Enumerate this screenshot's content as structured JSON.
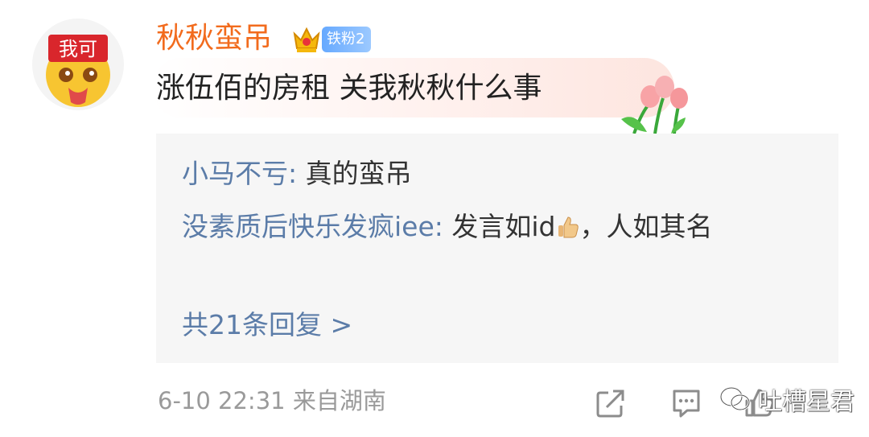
{
  "comment": {
    "username": "秋秋蛮吊",
    "badge": {
      "crown_icon": "crown-icon",
      "fan_label": "铁粉2"
    },
    "text": "涨伍佰的房租 关我秋秋什么事",
    "avatar_text": "我可",
    "decoration_icon": "tulip-icon"
  },
  "replies": [
    {
      "author": "小马不亏",
      "separator": ": ",
      "text": "真的蛮吊"
    },
    {
      "author": "没素质后快乐发疯iee",
      "separator": ": ",
      "text_before": "发言如id",
      "text_after": "，人如其名",
      "emoji": "thumbs-up-icon"
    }
  ],
  "more_replies": "共21条回复 >",
  "footer": {
    "timestamp": "6-10 22:31 来自湖南",
    "actions": [
      {
        "name": "share",
        "icon": "share-icon"
      },
      {
        "name": "comment",
        "icon": "comment-icon"
      },
      {
        "name": "like",
        "icon": "like-icon"
      }
    ]
  },
  "watermark": {
    "text": "吐槽星君"
  }
}
